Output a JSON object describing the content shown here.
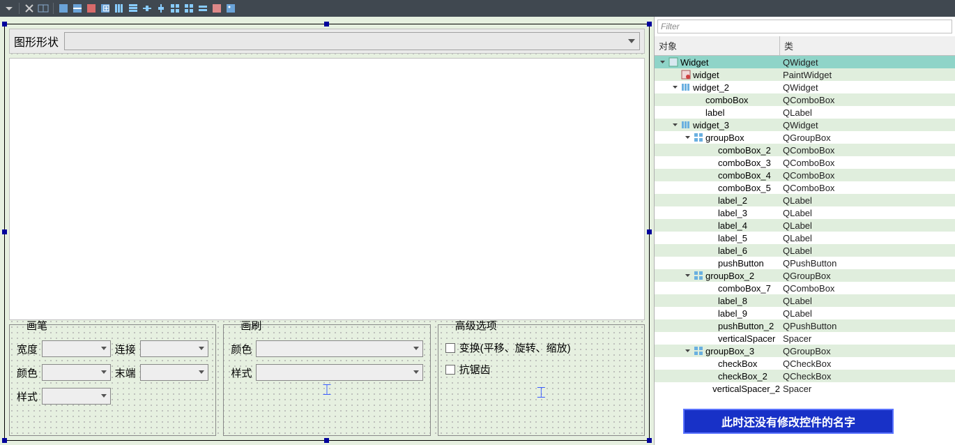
{
  "toolbar": {
    "icons": [
      "dropdown",
      "close",
      "hsplit",
      "copy",
      "paste",
      "cut",
      "form",
      "cols",
      "rows",
      "halign",
      "valign",
      "grid",
      "grid2",
      "gridh",
      "break",
      "image"
    ]
  },
  "designer": {
    "topLabel": "图形形状",
    "groups": {
      "pen": {
        "title": "画笔",
        "width": "宽度",
        "join": "连接",
        "color": "颜色",
        "cap": "末端",
        "style": "样式"
      },
      "brush": {
        "title": "画刷",
        "color": "颜色",
        "style": "样式"
      },
      "advanced": {
        "title": "高级选项",
        "transform": "变换(平移、旋转、缩放)",
        "antialias": "抗锯齿"
      }
    }
  },
  "inspector": {
    "filterPlaceholder": "Filter",
    "headers": {
      "object": "对象",
      "class": "类"
    },
    "rows": [
      {
        "depth": 0,
        "expand": "open",
        "icon": "widget",
        "name": "Widget",
        "cls": "QWidget",
        "sel": true
      },
      {
        "depth": 1,
        "expand": "",
        "icon": "redwidget",
        "name": "widget",
        "cls": "PaintWidget"
      },
      {
        "depth": 1,
        "expand": "open",
        "icon": "layout",
        "name": "widget_2",
        "cls": "QWidget"
      },
      {
        "depth": 2,
        "expand": "",
        "icon": "",
        "name": "comboBox",
        "cls": "QComboBox"
      },
      {
        "depth": 2,
        "expand": "",
        "icon": "",
        "name": "label",
        "cls": "QLabel"
      },
      {
        "depth": 1,
        "expand": "open",
        "icon": "layout",
        "name": "widget_3",
        "cls": "QWidget"
      },
      {
        "depth": 2,
        "expand": "open",
        "icon": "grid",
        "name": "groupBox",
        "cls": "QGroupBox"
      },
      {
        "depth": 3,
        "expand": "",
        "icon": "",
        "name": "comboBox_2",
        "cls": "QComboBox"
      },
      {
        "depth": 3,
        "expand": "",
        "icon": "",
        "name": "comboBox_3",
        "cls": "QComboBox"
      },
      {
        "depth": 3,
        "expand": "",
        "icon": "",
        "name": "comboBox_4",
        "cls": "QComboBox"
      },
      {
        "depth": 3,
        "expand": "",
        "icon": "",
        "name": "comboBox_5",
        "cls": "QComboBox"
      },
      {
        "depth": 3,
        "expand": "",
        "icon": "",
        "name": "label_2",
        "cls": "QLabel"
      },
      {
        "depth": 3,
        "expand": "",
        "icon": "",
        "name": "label_3",
        "cls": "QLabel"
      },
      {
        "depth": 3,
        "expand": "",
        "icon": "",
        "name": "label_4",
        "cls": "QLabel"
      },
      {
        "depth": 3,
        "expand": "",
        "icon": "",
        "name": "label_5",
        "cls": "QLabel"
      },
      {
        "depth": 3,
        "expand": "",
        "icon": "",
        "name": "label_6",
        "cls": "QLabel"
      },
      {
        "depth": 3,
        "expand": "",
        "icon": "",
        "name": "pushButton",
        "cls": "QPushButton"
      },
      {
        "depth": 2,
        "expand": "open",
        "icon": "grid",
        "name": "groupBox_2",
        "cls": "QGroupBox"
      },
      {
        "depth": 3,
        "expand": "",
        "icon": "",
        "name": "comboBox_7",
        "cls": "QComboBox"
      },
      {
        "depth": 3,
        "expand": "",
        "icon": "",
        "name": "label_8",
        "cls": "QLabel"
      },
      {
        "depth": 3,
        "expand": "",
        "icon": "",
        "name": "label_9",
        "cls": "QLabel"
      },
      {
        "depth": 3,
        "expand": "",
        "icon": "",
        "name": "pushButton_2",
        "cls": "QPushButton"
      },
      {
        "depth": 3,
        "expand": "",
        "icon": "",
        "name": "verticalSpacer",
        "cls": "Spacer"
      },
      {
        "depth": 2,
        "expand": "open",
        "icon": "grid",
        "name": "groupBox_3",
        "cls": "QGroupBox"
      },
      {
        "depth": 3,
        "expand": "",
        "icon": "",
        "name": "checkBox",
        "cls": "QCheckBox"
      },
      {
        "depth": 3,
        "expand": "",
        "icon": "",
        "name": "checkBox_2",
        "cls": "QCheckBox"
      },
      {
        "depth": 3,
        "expand": "",
        "icon": "",
        "name": "verticalSpacer_2",
        "cls": "Spacer"
      }
    ]
  },
  "callout": "此时还没有修改控件的名字"
}
